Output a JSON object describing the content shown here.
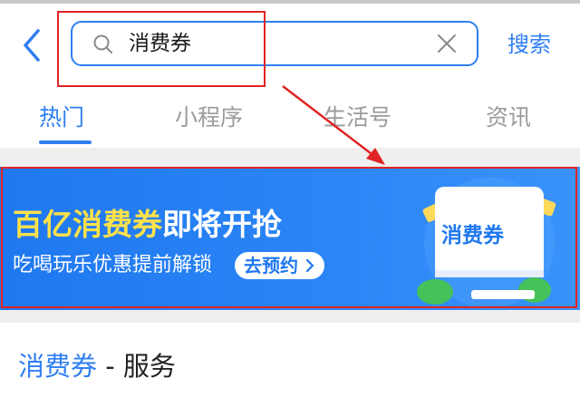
{
  "header": {
    "search_query": "消费券",
    "search_button": "搜索"
  },
  "tabs": [
    {
      "label": "热门",
      "active": true
    },
    {
      "label": "小程序",
      "active": false
    },
    {
      "label": "生活号",
      "active": false
    },
    {
      "label": "资讯",
      "active": false
    }
  ],
  "banner": {
    "title_highlight": "百亿消费券",
    "title_rest": "即将开抢",
    "subtitle": "吃喝玩乐优惠提前解锁",
    "cta": "去预约",
    "coupon_label": "消费券"
  },
  "result": {
    "keyword": "消费券",
    "separator": " - ",
    "category": "服务"
  },
  "colors": {
    "accent": "#2f7ff2",
    "banner_blue": "#1f78f0",
    "highlight_yellow": "#ffe14a",
    "annotation_red": "#e02424"
  },
  "icons": {
    "back": "chevron-left-icon",
    "search": "search-icon",
    "clear": "close-icon",
    "cta_arrow": "chevron-right-icon"
  }
}
